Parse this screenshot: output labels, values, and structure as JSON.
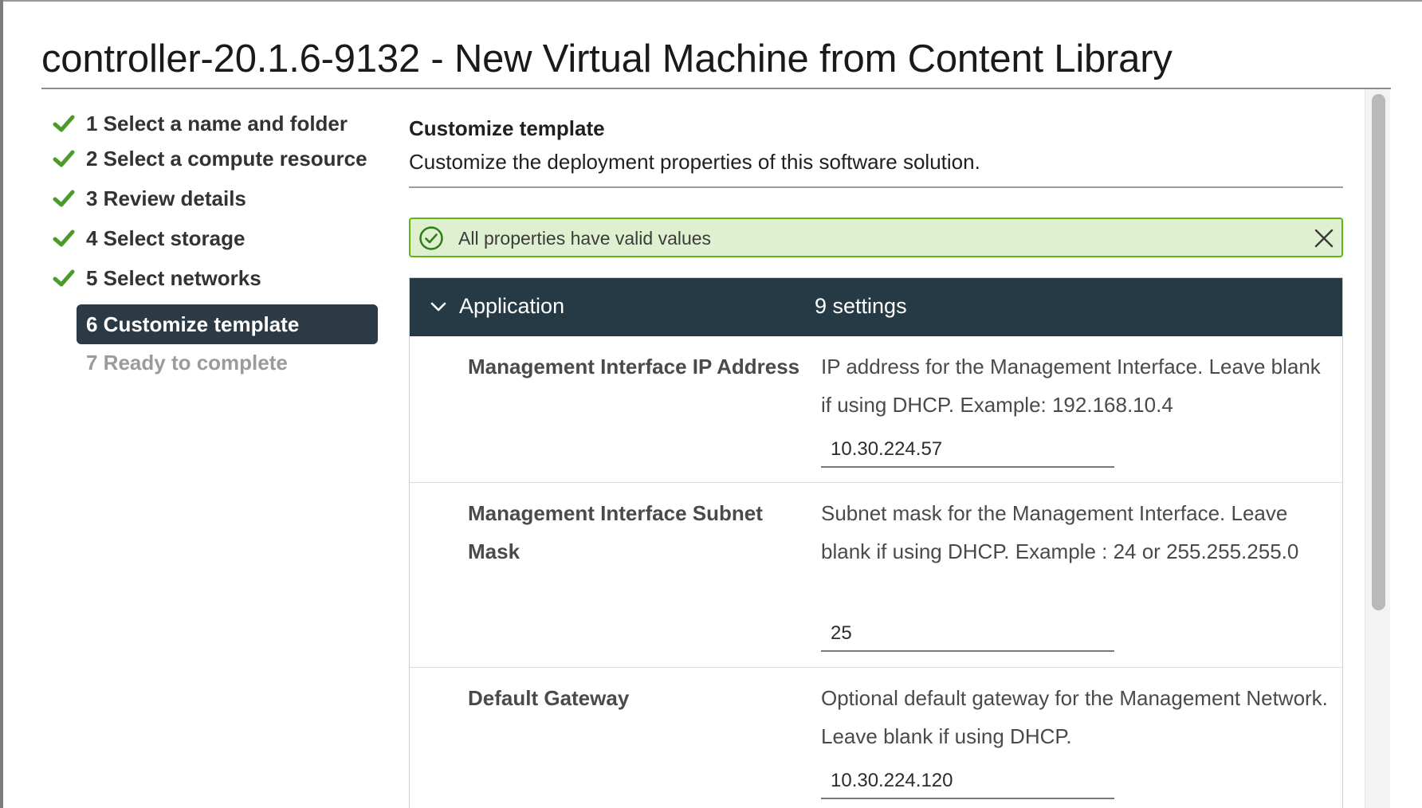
{
  "window": {
    "title": "controller-20.1.6-9132 - New Virtual Machine from Content Library"
  },
  "wizard": {
    "steps": [
      {
        "label": "1 Select a name and folder",
        "state": "complete"
      },
      {
        "label": "2 Select a compute resource",
        "state": "complete"
      },
      {
        "label": "3 Review details",
        "state": "complete"
      },
      {
        "label": "4 Select storage",
        "state": "complete"
      },
      {
        "label": "5 Select networks",
        "state": "complete"
      },
      {
        "label": "6 Customize template",
        "state": "active"
      },
      {
        "label": "7 Ready to complete",
        "state": "disabled"
      }
    ]
  },
  "main": {
    "heading": "Customize template",
    "description": "Customize the deployment properties of this software solution.",
    "alert": {
      "message": "All properties have valid values",
      "icon": "check-circle-icon",
      "close_icon": "close-icon",
      "color": "#60b515"
    },
    "group": {
      "name": "Application",
      "count": "9 settings",
      "icon": "chevron-down-icon",
      "color": "#263a46"
    },
    "properties": [
      {
        "name": "Management Interface IP Address",
        "description": "IP address for the Management Interface. Leave blank if using DHCP. Example: 192.168.10.4",
        "value": "10.30.224.57"
      },
      {
        "name": "Management Interface Subnet Mask",
        "description": "Subnet mask for the Management Interface. Leave blank if using DHCP. Example : 24 or 255.255.255.0",
        "value": "25"
      },
      {
        "name": "Default Gateway",
        "description": "Optional default gateway for the Management Network. Leave blank if using DHCP.",
        "value": "10.30.224.120"
      }
    ]
  },
  "colors": {
    "check": "#4c9a2a",
    "active_step": "#2b3a44"
  }
}
